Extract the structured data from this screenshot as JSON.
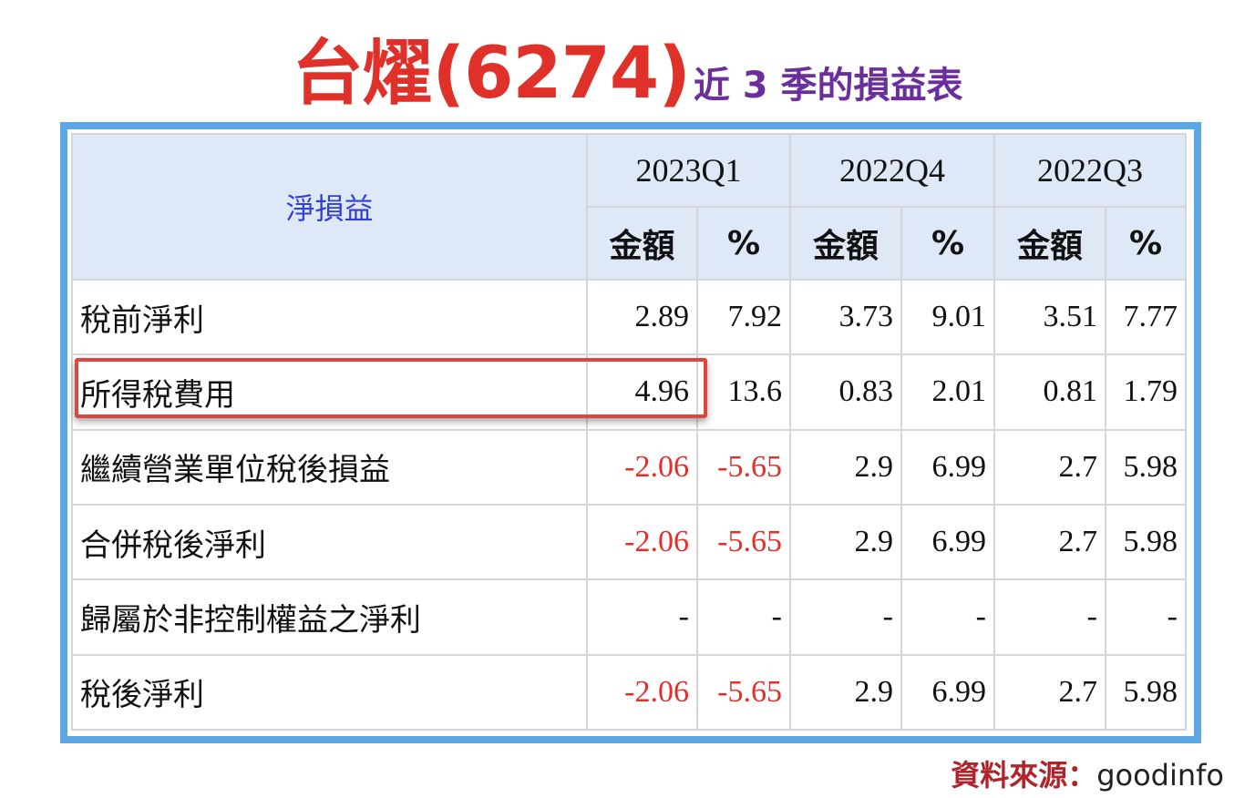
{
  "title": {
    "main": "台燿(6274)",
    "sub": "近 3 季的損益表"
  },
  "table": {
    "corner_label": "淨損益",
    "quarters": [
      "2023Q1",
      "2022Q4",
      "2022Q3"
    ],
    "sub_headers": [
      "金額",
      "%"
    ],
    "rows": [
      {
        "label": "稅前淨利",
        "cells": [
          "2.89",
          "7.92",
          "3.73",
          "9.01",
          "3.51",
          "7.77"
        ]
      },
      {
        "label": "所得稅費用",
        "cells": [
          "4.96",
          "13.6",
          "0.83",
          "2.01",
          "0.81",
          "1.79"
        ]
      },
      {
        "label": "繼續營業單位稅後損益",
        "cells": [
          "-2.06",
          "-5.65",
          "2.9",
          "6.99",
          "2.7",
          "5.98"
        ]
      },
      {
        "label": "合併稅後淨利",
        "cells": [
          "-2.06",
          "-5.65",
          "2.9",
          "6.99",
          "2.7",
          "5.98"
        ]
      },
      {
        "label": "歸屬於非控制權益之淨利",
        "cells": [
          "-",
          "-",
          "-",
          "-",
          "-",
          "-"
        ]
      },
      {
        "label": "稅後淨利",
        "cells": [
          "-2.06",
          "-5.65",
          "2.9",
          "6.99",
          "2.7",
          "5.98"
        ]
      }
    ]
  },
  "source": {
    "label": "資料來源：",
    "value": "goodinfo"
  },
  "colors": {
    "title": "#e0302a",
    "subtitle": "#6a2f9a",
    "frame": "#5ba6e3",
    "negative": "#e0302a",
    "highlight": "#d9473e",
    "header_bg": "#dfe8f7"
  }
}
